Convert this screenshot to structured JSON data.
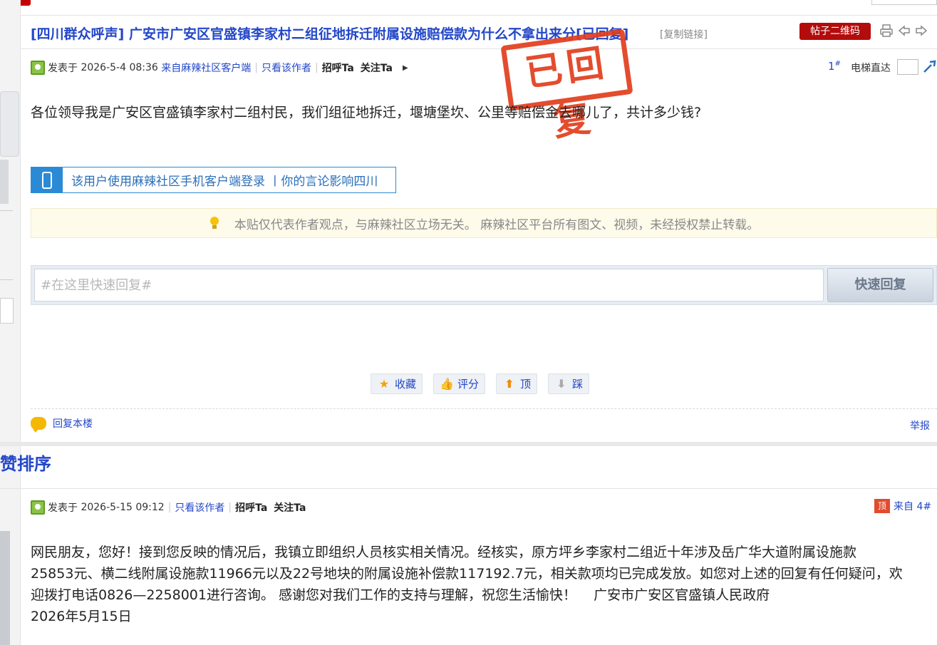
{
  "title": {
    "main": "[四川群众呼声] 广安市广安区官盛镇李家村二组征地拆迁附属设施赔偿款为什么不拿出来分[已回复]",
    "copy_link": "[复制链接]",
    "qr_button": "帖子二维码"
  },
  "post1": {
    "posted_prefix": "发表于",
    "date": "2026-5-4 08:36",
    "source": "来自麻辣社区客户端",
    "only_author": "只看该作者",
    "greet": "招呼Ta",
    "follow": "关注Ta",
    "floor": "1",
    "elevator": "电梯直达",
    "stamp": "已回复",
    "body": "各位领导我是广安区官盛镇李家村二组村民，我们组征地拆迁，堰塘堡坎、公里等赔偿金去哪儿了，共计多少钱?",
    "mobile_notice": "该用户使用麻辣社区手机客户端登录 丨你的言论影响四川",
    "disclaimer": "本贴仅代表作者观点，与麻辣社区立场无关。 麻辣社区平台所有图文、视频，未经授权禁止转载。",
    "quick_reply_placeholder": "#在这里快速回复#",
    "quick_reply_button": "快速回复",
    "actions": {
      "favorite": "收藏",
      "rate": "评分",
      "up": "顶",
      "down": "踩"
    },
    "reply_floor": "回复本楼",
    "report": "举报"
  },
  "section": {
    "sort_title": "赞排序"
  },
  "post2": {
    "posted_prefix": "发表于",
    "date": "2026-5-15 09:12",
    "only_author": "只看该作者",
    "greet": "招呼Ta",
    "follow": "关注Ta",
    "top_badge": "顶",
    "from_floor": "来自 4#",
    "body_lines": [
      "网民朋友，您好！接到您反映的情况后，我镇立即组织人员核实相关情况。经核实，原方坪乡李家村二组近十年涉及岳广华大道附属设施款",
      "25853元、横二线附属设施款11966元以及22号地块的附属设施补偿款117192.7元，相关款项均已完成发放。如您对上述的回复有任何疑问，欢",
      "迎拨打电话0826—2258001进行咨询。 感谢您对我们工作的支持与理解，祝您生活愉快！    广安市广安区官盛镇人民政府",
      "2026年5月15日"
    ]
  },
  "colors": {
    "link": "#2347c8",
    "stamp": "#e23d1d",
    "qr_button": "#b30c0c"
  }
}
